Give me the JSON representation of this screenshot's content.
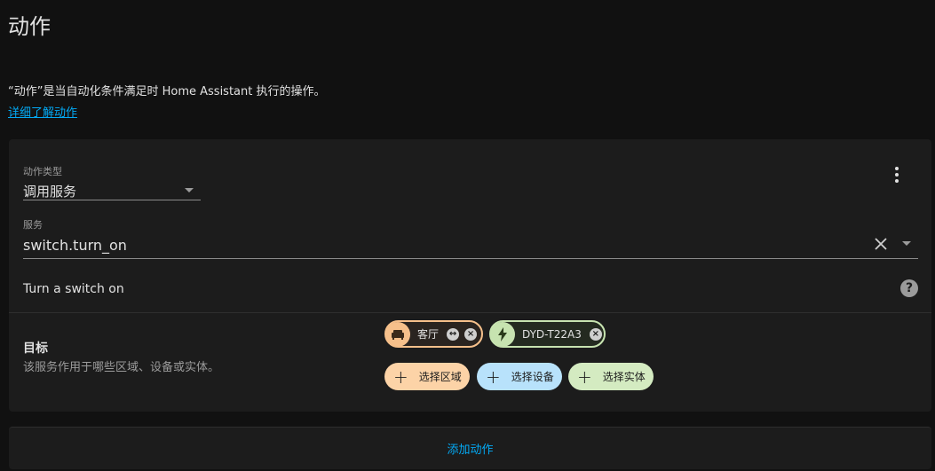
{
  "page": {
    "title": "动作",
    "intro": "“动作”是当自动化条件满足时 Home Assistant 执行的操作。",
    "learn_more": "详细了解动作"
  },
  "action": {
    "type_label": "动作类型",
    "type_value": "调用服务",
    "service_label": "服务",
    "service_value": "switch.turn_on",
    "service_description": "Turn a switch on"
  },
  "target": {
    "title": "目标",
    "description": "该服务作用于哪些区域、设备或实体。",
    "selected": [
      {
        "kind": "area",
        "label": "客厅",
        "icon": "sofa-icon",
        "color": "#f6c08b"
      },
      {
        "kind": "device",
        "label": "DYD-T22A3",
        "icon": "lightning-icon",
        "color": "#c7e3b0"
      }
    ],
    "add_area": "选择区域",
    "add_device": "选择设备",
    "add_entity": "选择实体"
  },
  "footer": {
    "add_action": "添加动作"
  },
  "colors": {
    "accent": "#03a9f4",
    "area": "#fcd3a7",
    "device": "#b8e2fb",
    "entity": "#d4ebc1"
  }
}
